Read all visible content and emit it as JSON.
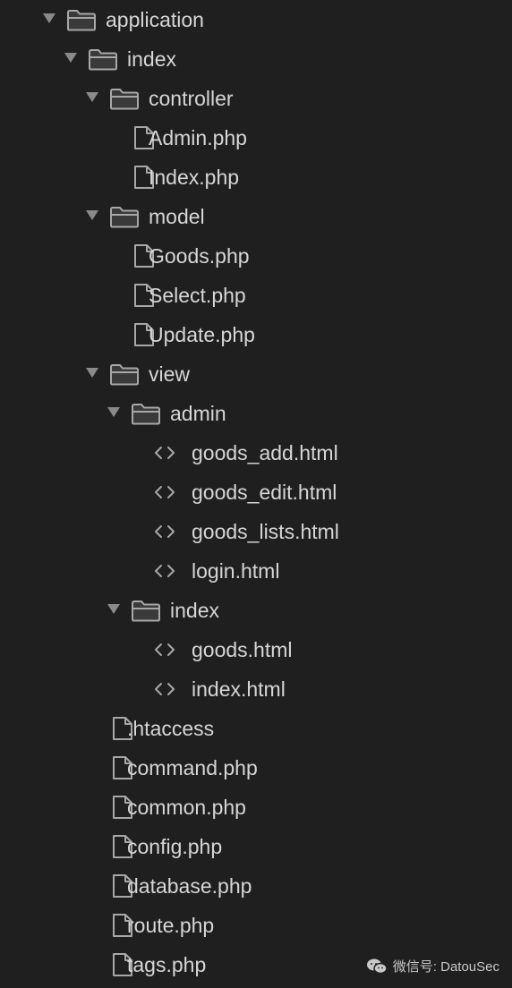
{
  "tree": [
    {
      "label": "application",
      "type": "folder",
      "depth": 0
    },
    {
      "label": "index",
      "type": "folder",
      "depth": 1
    },
    {
      "label": "controller",
      "type": "folder",
      "depth": 2
    },
    {
      "label": "Admin.php",
      "type": "file",
      "depth": 3
    },
    {
      "label": "Index.php",
      "type": "file",
      "depth": 3
    },
    {
      "label": "model",
      "type": "folder",
      "depth": 2
    },
    {
      "label": "Goods.php",
      "type": "file",
      "depth": 3
    },
    {
      "label": "Select.php",
      "type": "file",
      "depth": 3
    },
    {
      "label": "Update.php",
      "type": "file",
      "depth": 3
    },
    {
      "label": "view",
      "type": "folder",
      "depth": 2
    },
    {
      "label": "admin",
      "type": "folder",
      "depth": 3
    },
    {
      "label": "goods_add.html",
      "type": "html",
      "depth": 4
    },
    {
      "label": "goods_edit.html",
      "type": "html",
      "depth": 4
    },
    {
      "label": "goods_lists.html",
      "type": "html",
      "depth": 4
    },
    {
      "label": "login.html",
      "type": "html",
      "depth": 4
    },
    {
      "label": "index",
      "type": "folder",
      "depth": 3
    },
    {
      "label": "goods.html",
      "type": "html",
      "depth": 4
    },
    {
      "label": "index.html",
      "type": "html",
      "depth": 4
    },
    {
      "label": ".htaccess",
      "type": "file",
      "depth": 2
    },
    {
      "label": "command.php",
      "type": "file",
      "depth": 2
    },
    {
      "label": "common.php",
      "type": "file",
      "depth": 2
    },
    {
      "label": "config.php",
      "type": "file",
      "depth": 2
    },
    {
      "label": "database.php",
      "type": "file",
      "depth": 2
    },
    {
      "label": "route.php",
      "type": "file",
      "depth": 2
    },
    {
      "label": "tags.php",
      "type": "file",
      "depth": 2
    }
  ],
  "watermark": {
    "text": "微信号: DatouSec",
    "icon": "wechat-icon"
  },
  "colors": {
    "background": "#1f1f1f",
    "text": "#d6d6d6",
    "icon": "#a8a8a8",
    "arrow": "#8a8a8a"
  }
}
